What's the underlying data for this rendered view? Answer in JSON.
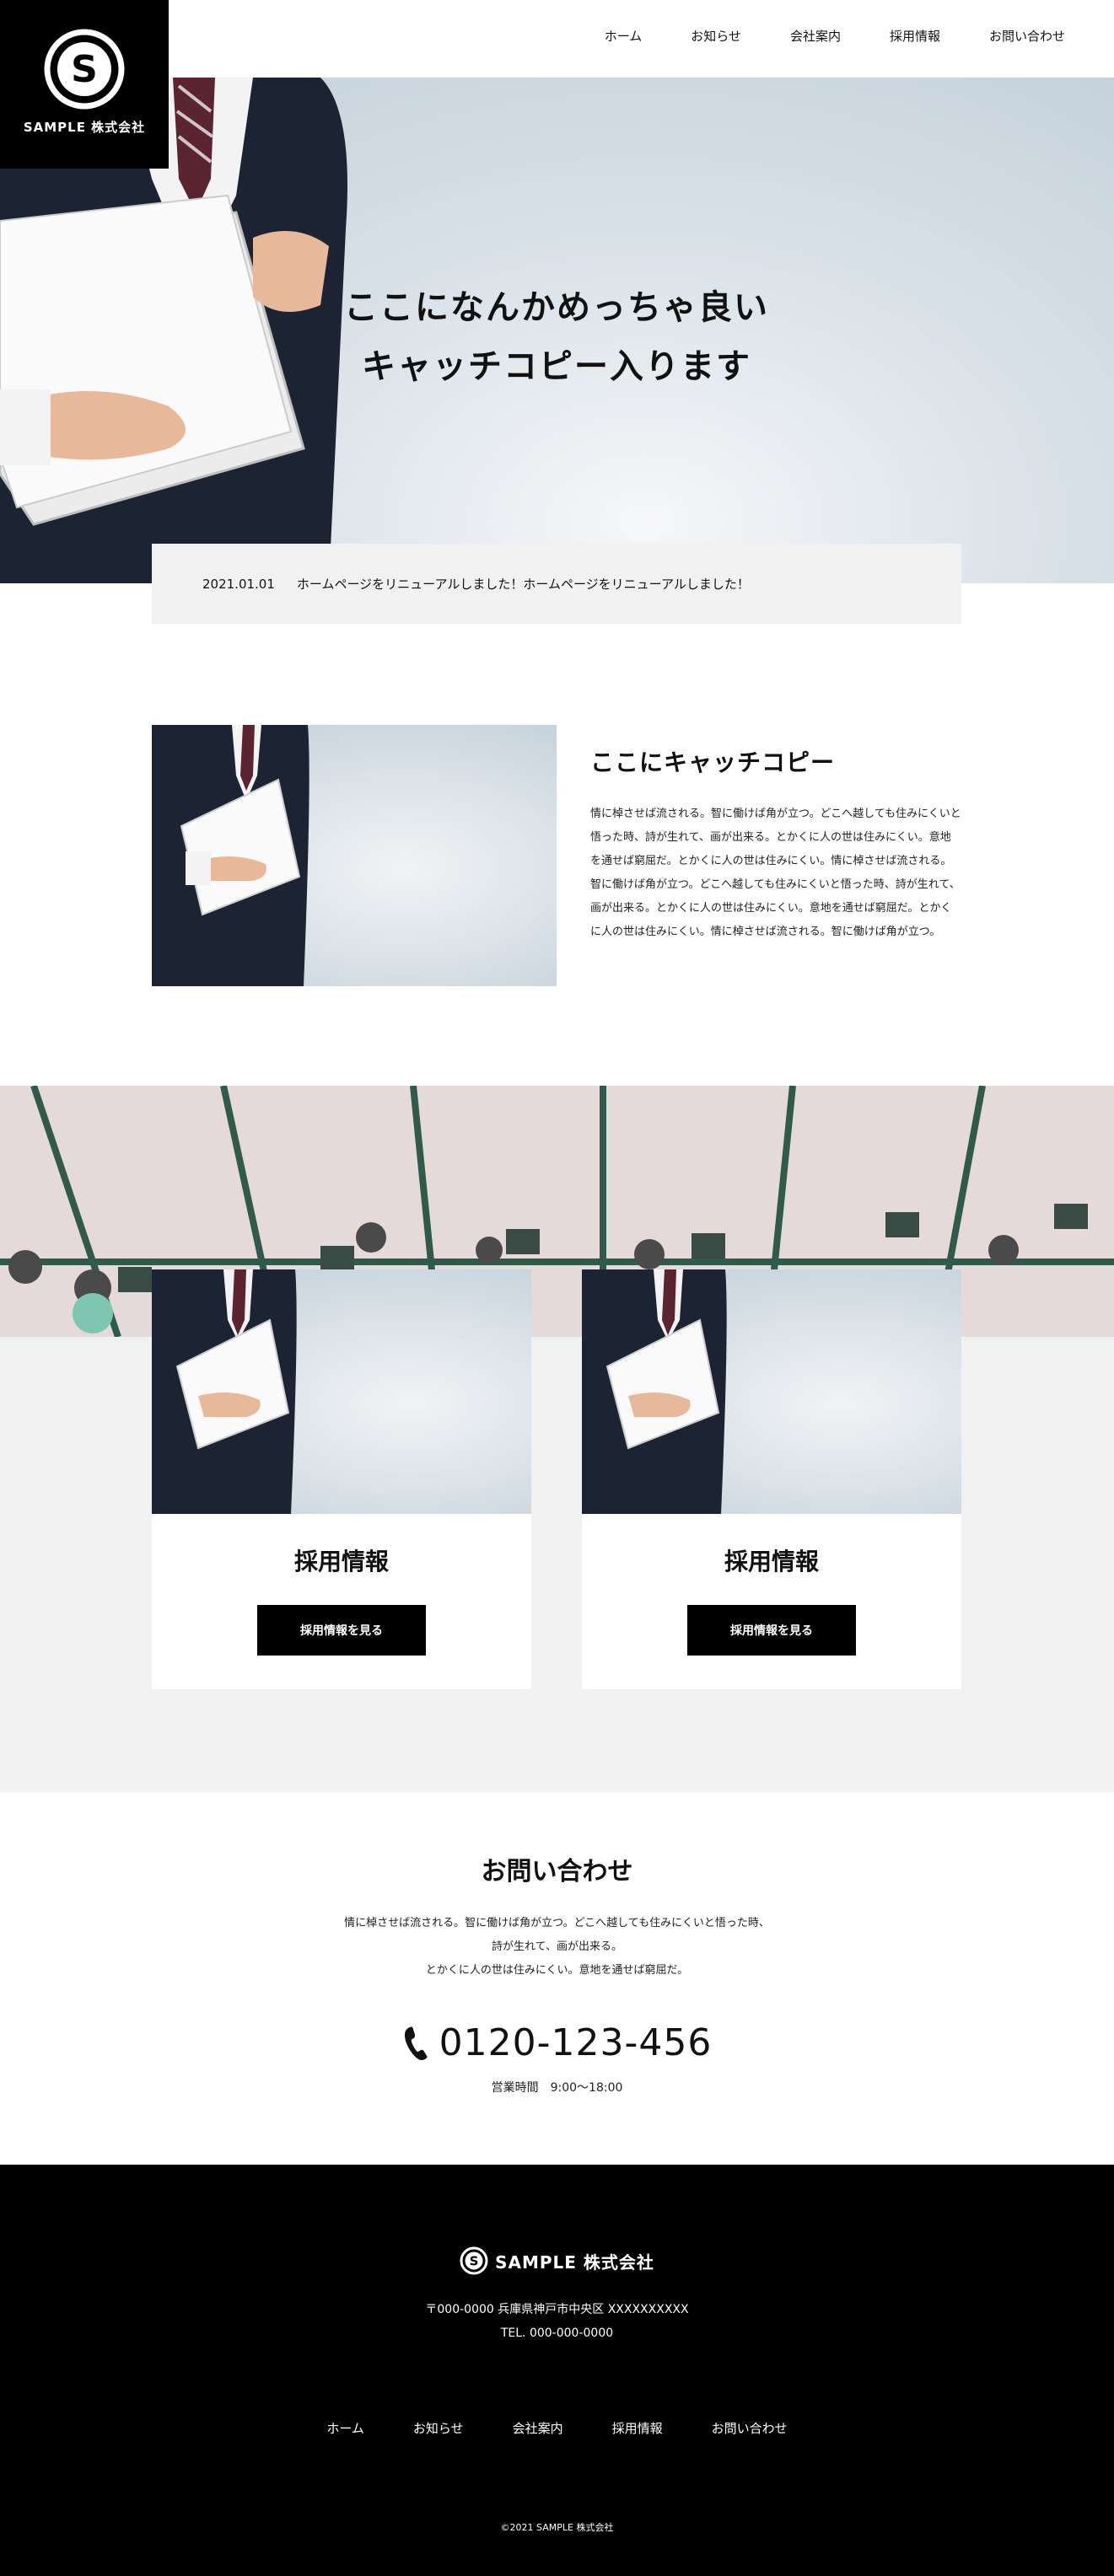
{
  "brand": {
    "name": "SAMPLE 株式会社",
    "logo_letter": "S"
  },
  "nav": [
    {
      "label": "ホーム"
    },
    {
      "label": "お知らせ"
    },
    {
      "label": "会社案内"
    },
    {
      "label": "採用情報"
    },
    {
      "label": "お問い合わせ"
    }
  ],
  "hero": {
    "line1": "ここになんかめっちゃ良い",
    "line2": "キャッチコピー入ります"
  },
  "news": {
    "date": "2021.01.01",
    "text": "ホームページをリニューアルしました！ホームページをリニューアルしました！"
  },
  "intro": {
    "title": "ここにキャッチコピー",
    "body": "情に棹させば流される。智に働けば角が立つ。どこへ越しても住みにくいと悟った時、詩が生れて、画が出来る。とかくに人の世は住みにくい。意地を通せば窮屈だ。とかくに人の世は住みにくい。情に棹させば流される。智に働けば角が立つ。どこへ越しても住みにくいと悟った時、詩が生れて、画が出来る。とかくに人の世は住みにくい。意地を通せば窮屈だ。とかくに人の世は住みにくい。情に棹させば流される。智に働けば角が立つ。"
  },
  "cards": [
    {
      "title": "採用情報",
      "button": "採用情報を見る"
    },
    {
      "title": "採用情報",
      "button": "採用情報を見る"
    }
  ],
  "contact": {
    "title": "お問い合わせ",
    "lines": [
      "情に棹させば流される。智に働けば角が立つ。どこへ越しても住みにくいと悟った時、",
      "詩が生れて、画が出来る。",
      "とかくに人の世は住みにくい。意地を通せば窮屈だ。"
    ],
    "phone": "0120-123-456",
    "hours": "営業時間　9:00〜18:00"
  },
  "footer": {
    "address": "〒000-0000 兵庫県神戸市中央区 XXXXXXXXXX",
    "tel": "TEL. 000-000-0000",
    "nav": [
      {
        "label": "ホーム"
      },
      {
        "label": "お知らせ"
      },
      {
        "label": "会社案内"
      },
      {
        "label": "採用情報"
      },
      {
        "label": "お問い合わせ"
      }
    ],
    "copyright": "©2021 SAMPLE 株式会社"
  },
  "colors": {
    "primary": "#000000",
    "light_gray": "#f1f1f1",
    "photo_blue": "#bccbd6"
  },
  "icons": [
    "s-logo-icon",
    "phone-icon"
  ]
}
